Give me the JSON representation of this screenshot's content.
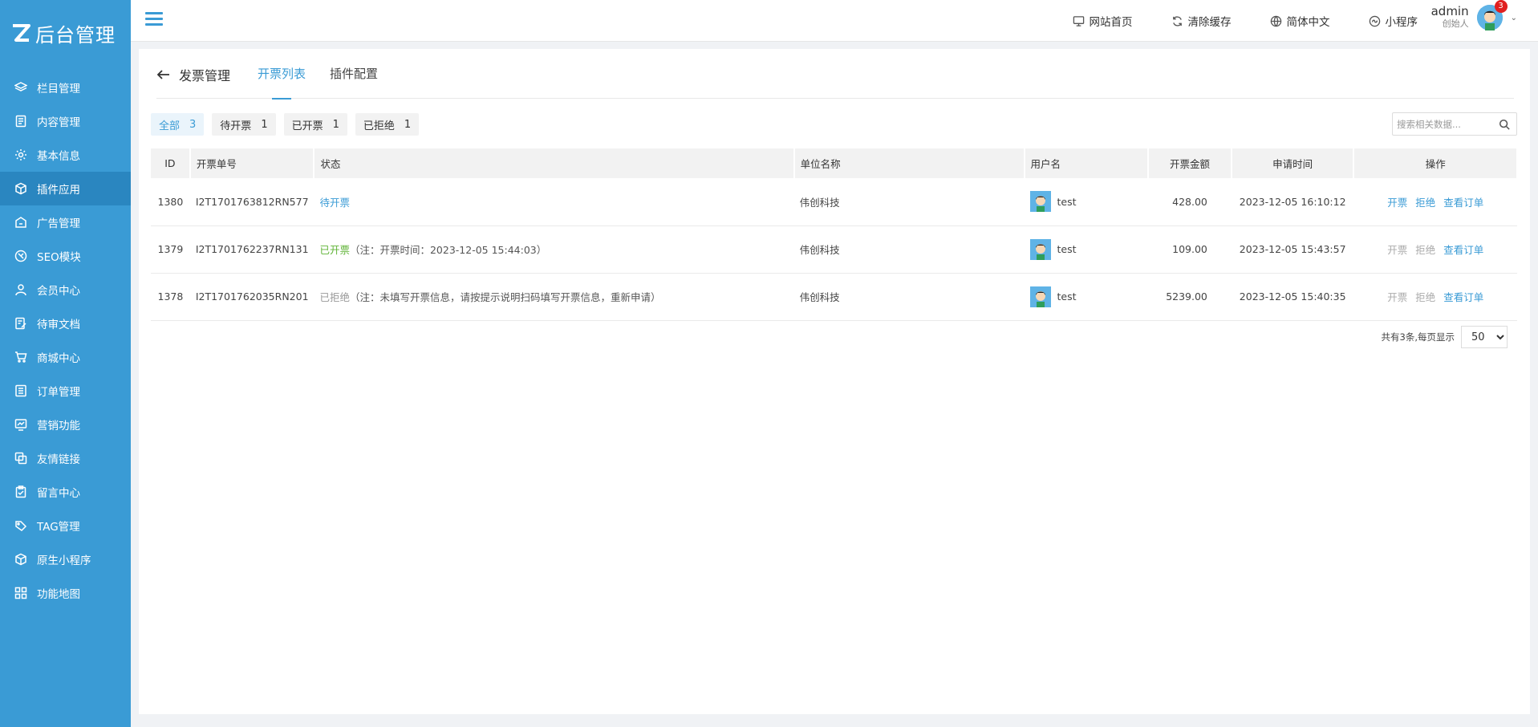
{
  "logo": {
    "text": "后台管理"
  },
  "colors": {
    "accent": "#3a9bd5",
    "sidebar": "#3a9bd5",
    "success": "#5fb336",
    "badge": "#e02020"
  },
  "sidebar": {
    "items": [
      {
        "label": "栏目管理",
        "icon": "layers-icon"
      },
      {
        "label": "内容管理",
        "icon": "document-icon"
      },
      {
        "label": "基本信息",
        "icon": "gear-icon"
      },
      {
        "label": "插件应用",
        "icon": "cube-icon",
        "active": true
      },
      {
        "label": "广告管理",
        "icon": "ad-icon"
      },
      {
        "label": "SEO模块",
        "icon": "seo-icon"
      },
      {
        "label": "会员中心",
        "icon": "user-icon"
      },
      {
        "label": "待审文档",
        "icon": "edit-doc-icon"
      },
      {
        "label": "商城中心",
        "icon": "cart-icon"
      },
      {
        "label": "订单管理",
        "icon": "list-icon"
      },
      {
        "label": "营销功能",
        "icon": "chart-icon"
      },
      {
        "label": "友情链接",
        "icon": "link-icon"
      },
      {
        "label": "留言中心",
        "icon": "clipboard-icon"
      },
      {
        "label": "TAG管理",
        "icon": "tag-icon"
      },
      {
        "label": "原生小程序",
        "icon": "box-icon"
      },
      {
        "label": "功能地图",
        "icon": "grid-icon"
      }
    ]
  },
  "header": {
    "links": [
      {
        "label": "网站首页",
        "icon": "monitor-icon"
      },
      {
        "label": "清除缓存",
        "icon": "refresh-icon"
      },
      {
        "label": "简体中文",
        "icon": "globe-icon"
      },
      {
        "label": "小程序",
        "icon": "miniapp-icon"
      }
    ],
    "user": {
      "name": "admin",
      "role": "创始人",
      "badge": "3"
    }
  },
  "page": {
    "back_label": "发票管理",
    "tabs": [
      {
        "label": "开票列表",
        "active": true
      },
      {
        "label": "插件配置"
      }
    ]
  },
  "filters": [
    {
      "label": "全部",
      "count": "3",
      "active": true
    },
    {
      "label": "待开票",
      "count": "1"
    },
    {
      "label": "已开票",
      "count": "1"
    },
    {
      "label": "已拒绝",
      "count": "1"
    }
  ],
  "search": {
    "placeholder": "搜索相关数据..."
  },
  "table": {
    "headers": [
      "ID",
      "开票单号",
      "状态",
      "单位名称",
      "用户名",
      "开票金额",
      "申请时间",
      "操作"
    ],
    "rows": [
      {
        "id": "1380",
        "no": "I2T1701763812RN577",
        "status": "待开票",
        "note": "",
        "company": "伟创科技",
        "user": "test",
        "amount": "428.00",
        "time": "2023-12-05 16:10:12",
        "ops": [
          "开票",
          "拒绝",
          "查看订单"
        ]
      },
      {
        "id": "1379",
        "no": "I2T1701762237RN131",
        "status": "已开票",
        "note": "（注：开票时间：2023-12-05 15:44:03）",
        "company": "伟创科技",
        "user": "test",
        "amount": "109.00",
        "time": "2023-12-05 15:43:57",
        "ops": [
          "开票",
          "拒绝",
          "查看订单"
        ]
      },
      {
        "id": "1378",
        "no": "I2T1701762035RN201",
        "status": "已拒绝",
        "note": "（注：未填写开票信息，请按提示说明扫码填写开票信息，重新申请）",
        "company": "伟创科技",
        "user": "test",
        "amount": "5239.00",
        "time": "2023-12-05 15:40:35",
        "ops": [
          "开票",
          "拒绝",
          "查看订单"
        ]
      }
    ]
  },
  "pager": {
    "summary": "共有3条,每页显示",
    "page_size": "50"
  }
}
